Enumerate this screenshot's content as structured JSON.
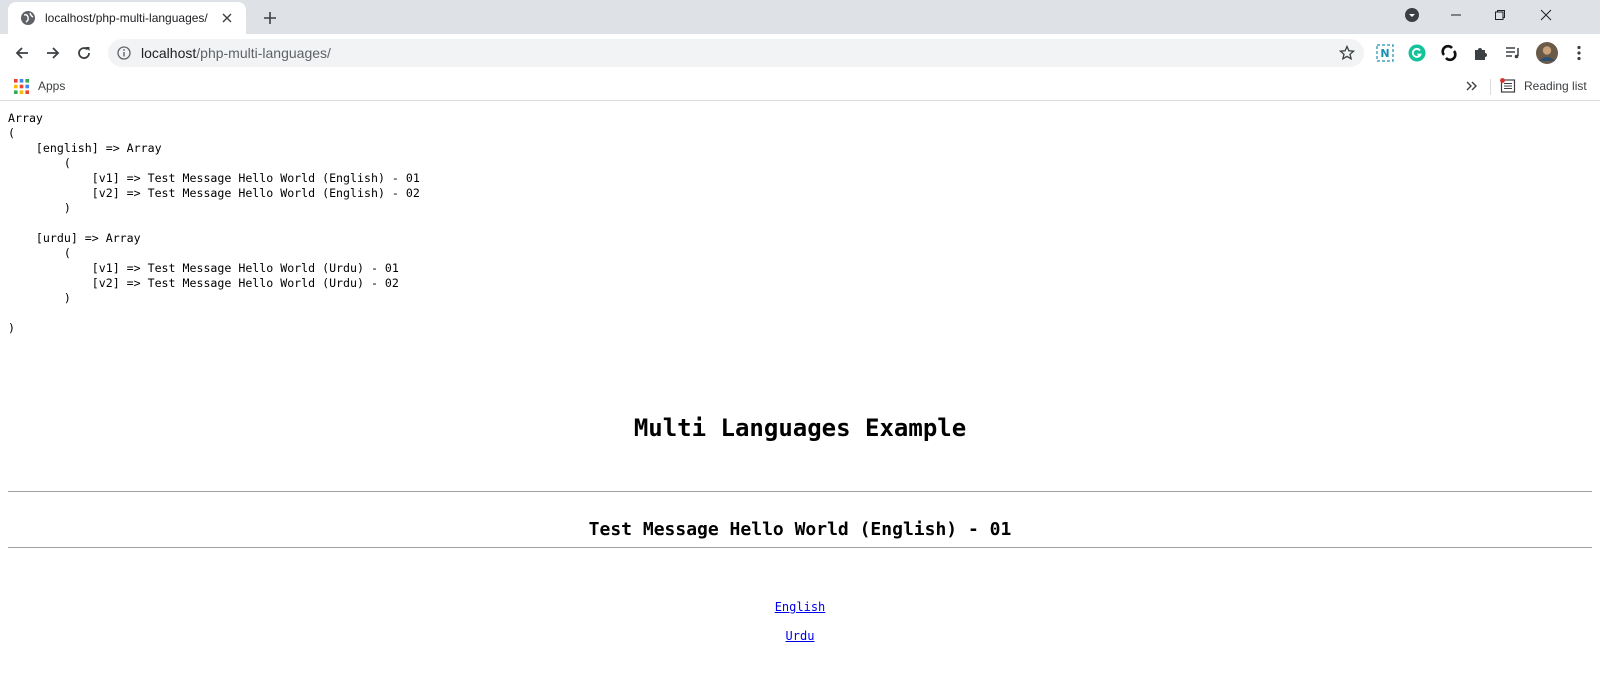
{
  "browser": {
    "tab_title": "localhost/php-multi-languages/",
    "url_host": "localhost",
    "url_path": "/php-multi-languages/",
    "bookmarks": {
      "apps_label": "Apps",
      "reading_list_label": "Reading list"
    },
    "icons": [
      "globe-icon",
      "close-icon",
      "plus-icon",
      "back-icon",
      "forward-icon",
      "reload-icon",
      "info-icon",
      "star-icon",
      "extension-icon",
      "profile-avatar"
    ]
  },
  "page": {
    "array_dump": "Array\n(\n    [english] => Array\n        (\n            [v1] => Test Message Hello World (English) - 01\n            [v2] => Test Message Hello World (English) - 02\n        )\n\n    [urdu] => Array\n        (\n            [v1] => Test Message Hello World (Urdu) - 01\n            [v2] => Test Message Hello World (Urdu) - 02\n        )\n\n)",
    "heading": "Multi Languages Example",
    "message": "Test Message Hello World (English) - 01",
    "links": {
      "english": "English",
      "urdu": "Urdu"
    }
  },
  "colors": {
    "tabstrip": "#dee1e6",
    "omnibox": "#f1f3f4",
    "link": "#0000ee",
    "grammarly": "#15c39a"
  }
}
